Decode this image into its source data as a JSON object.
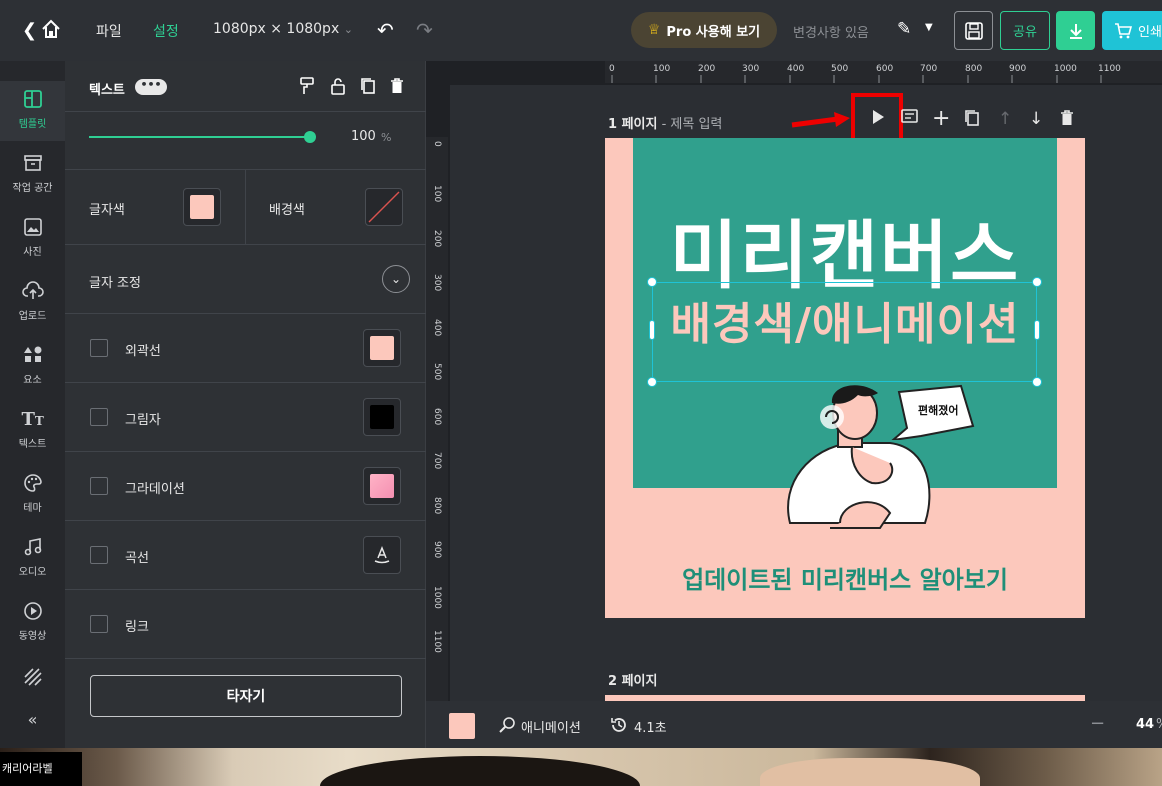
{
  "topbar": {
    "file_label": "파일",
    "settings_label": "설정",
    "size_label": "1080px × 1080px",
    "pro_label": "Pro 사용해 보기",
    "changes_label": "변경사항 있음",
    "share_label": "공유",
    "print_label": "인쇄"
  },
  "rail": {
    "items": [
      {
        "label": "템플릿",
        "icon": "template-icon"
      },
      {
        "label": "작업 공간",
        "icon": "archive-icon"
      },
      {
        "label": "사진",
        "icon": "image-icon"
      },
      {
        "label": "업로드",
        "icon": "cloud-upload-icon"
      },
      {
        "label": "요소",
        "icon": "shapes-icon"
      },
      {
        "label": "텍스트",
        "icon": "text-icon"
      },
      {
        "label": "테마",
        "icon": "palette-icon"
      },
      {
        "label": "오디오",
        "icon": "music-icon"
      },
      {
        "label": "동영상",
        "icon": "play-circle-icon"
      }
    ]
  },
  "panel": {
    "title": "텍스트",
    "more": "•••",
    "opacity_value": "100",
    "opacity_unit": "%",
    "text_color_label": "글자색",
    "text_color": "#fcc8bc",
    "bg_color_label": "배경색",
    "adjust_label": "글자 조정",
    "outline_label": "외곽선",
    "outline_color": "#fcc8bc",
    "shadow_label": "그림자",
    "shadow_color": "#000000",
    "gradient_label": "그라데이션",
    "curve_label": "곡선",
    "link_label": "링크",
    "typing_label": "타자기"
  },
  "canvas": {
    "ruler_top": [
      "0",
      "100",
      "200",
      "300",
      "400",
      "500",
      "600",
      "700",
      "800",
      "900",
      "1000",
      "1100"
    ],
    "ruler_left": [
      "0",
      "100",
      "200",
      "300",
      "400",
      "500",
      "600",
      "700",
      "800",
      "900",
      "1000",
      "1100"
    ],
    "page1_label": "1 페이지",
    "page1_sub": "- 제목 입력",
    "page2_label": "2 페이지",
    "headline": "미리캔버스",
    "subhead": "배경색/애니메이션",
    "bubble": "편해졌어",
    "bottom_text": "업데이트된 미리캔버스 알아보기",
    "teal_color": "#30a08d",
    "pink_color": "#fcc8bc"
  },
  "bottombar": {
    "animation_label": "애니메이션",
    "duration_label": "4.1초",
    "zoom_minus": "−",
    "zoom_value": "44",
    "zoom_unit": "%"
  },
  "photo": {
    "label": "캐리어라벨"
  }
}
